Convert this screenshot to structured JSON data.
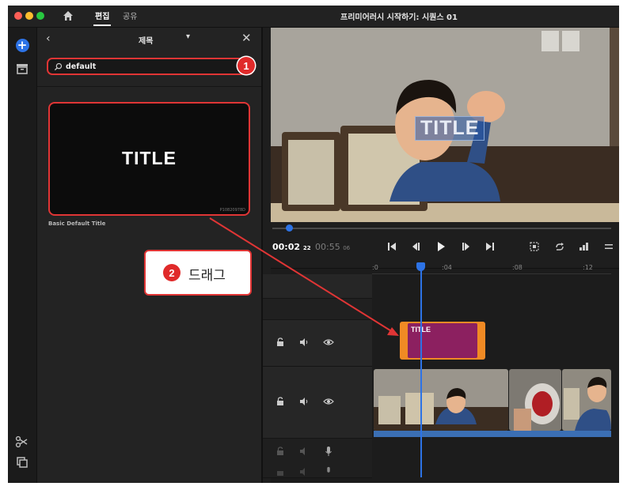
{
  "titlebar": {
    "tabs": [
      {
        "label": "편집",
        "active": true
      },
      {
        "label": "공유",
        "active": false
      }
    ],
    "window_title": "프리미어러시 시작하기: 시퀀스 01"
  },
  "panel": {
    "title": "제목",
    "search": {
      "value": "default",
      "placeholder": ""
    },
    "template": {
      "preview_text": "TITLE",
      "code": "P10820978D",
      "name": "Basic Default Title"
    }
  },
  "callouts": {
    "step1": "1",
    "step2": "2",
    "drag_label": "드래그"
  },
  "preview": {
    "overlay_title": "TITLE"
  },
  "transport": {
    "timecode": {
      "time": "00:02",
      "frames": "22"
    },
    "duration": {
      "time": "00:55",
      "frames": "06"
    },
    "scrub_progress": 0.05
  },
  "timeline": {
    "ruler_ticks": [
      ":0",
      ":04",
      ":08",
      ":12"
    ],
    "title_clip_label": "TITLE"
  },
  "colors": {
    "accent": "#2d73e6",
    "callout_red": "#e03535",
    "title_clip_orange": "#f08a24",
    "title_clip_purple": "#8c2060"
  },
  "icons": [
    "home-icon",
    "add-icon",
    "media-icon",
    "scissors-icon",
    "layers-icon",
    "back-icon",
    "chevron-down-icon",
    "close-icon",
    "search-icon",
    "lock-icon",
    "speaker-icon",
    "eye-icon",
    "mic-icon"
  ]
}
